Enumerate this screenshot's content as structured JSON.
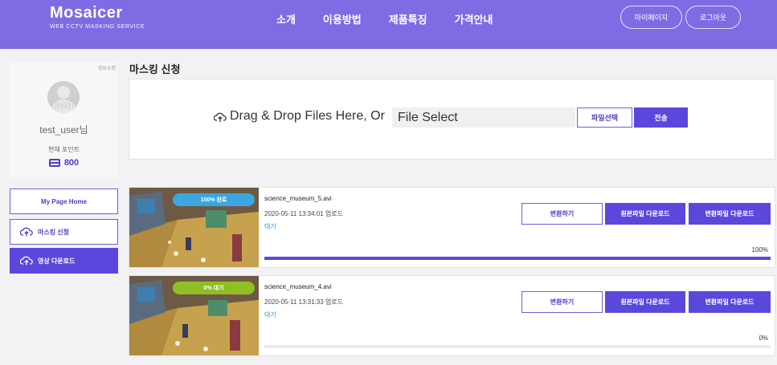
{
  "header": {
    "logo": "Mosaicer",
    "tagline": "WEB CCTV MASKING SERVICE",
    "nav": [
      "소개",
      "이용방법",
      "제품특징",
      "가격안내"
    ],
    "mypage_label": "마이페이지",
    "logout_label": "로그아웃",
    "brand_color": "#7d6ce3"
  },
  "profile": {
    "edit_link": "정보수정",
    "avatar_edit": "EDIT",
    "username": "test_user님",
    "points_label": "현재 포인트",
    "points": "800"
  },
  "sidebar": {
    "items": [
      {
        "label": "My Page Home",
        "icon": ""
      },
      {
        "label": "마스킹 신청",
        "icon": "cloud-upload-icon"
      },
      {
        "label": "영상 다운로드",
        "icon": "cloud-upload-icon"
      }
    ]
  },
  "main": {
    "title": "마스킹 신청",
    "upload": {
      "drop_text": "Drag & Drop Files Here, Or",
      "file_select": "File Select",
      "pick_label": "파일선택",
      "send_label": "전송"
    },
    "files": [
      {
        "name": "science_museum_5.avi",
        "date": "2020-05-11 13:34:01 업로드",
        "status": "대기",
        "badge": "100% 완료",
        "progress_text": "100%",
        "progress": 1.0,
        "convert_label": "변환하기",
        "orig_dl_label": "원본파일 다운로드",
        "conv_dl_label": "변환파일 다운로드"
      },
      {
        "name": "science_museum_4.avi",
        "date": "2020-05-11 13:31:33 업로드",
        "status": "대기",
        "badge": "0% 대기",
        "progress_text": "0%",
        "progress": 0.0,
        "convert_label": "변환하기",
        "orig_dl_label": "원본파일 다운로드",
        "conv_dl_label": "변환파일 다운로드"
      }
    ]
  }
}
